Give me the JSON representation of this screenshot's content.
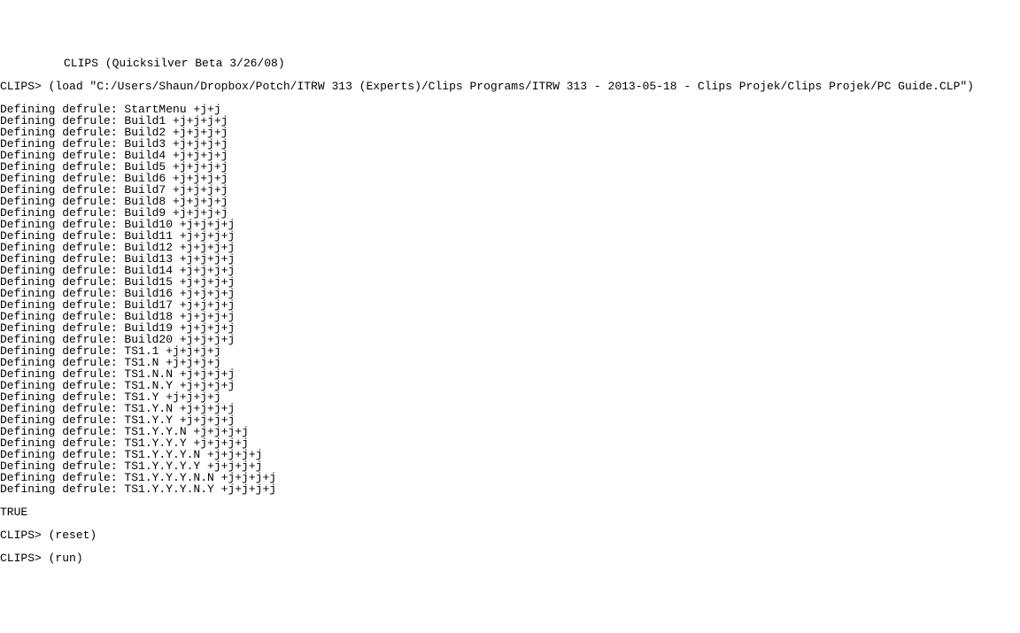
{
  "header": "CLIPS (Quicksilver Beta 3/26/08)",
  "load_line": "CLIPS> (load \"C:/Users/Shaun/Dropbox/Potch/ITRW 313 (Experts)/Clips Programs/ITRW 313 - 2013-05-18 - Clips Projek/Clips Projek/PC Guide.CLP\")",
  "defrules": [
    "Defining defrule: StartMenu +j+j",
    "Defining defrule: Build1 +j+j+j+j",
    "Defining defrule: Build2 +j+j+j+j",
    "Defining defrule: Build3 +j+j+j+j",
    "Defining defrule: Build4 +j+j+j+j",
    "Defining defrule: Build5 +j+j+j+j",
    "Defining defrule: Build6 +j+j+j+j",
    "Defining defrule: Build7 +j+j+j+j",
    "Defining defrule: Build8 +j+j+j+j",
    "Defining defrule: Build9 +j+j+j+j",
    "Defining defrule: Build10 +j+j+j+j",
    "Defining defrule: Build11 +j+j+j+j",
    "Defining defrule: Build12 +j+j+j+j",
    "Defining defrule: Build13 +j+j+j+j",
    "Defining defrule: Build14 +j+j+j+j",
    "Defining defrule: Build15 +j+j+j+j",
    "Defining defrule: Build16 +j+j+j+j",
    "Defining defrule: Build17 +j+j+j+j",
    "Defining defrule: Build18 +j+j+j+j",
    "Defining defrule: Build19 +j+j+j+j",
    "Defining defrule: Build20 +j+j+j+j",
    "Defining defrule: TS1.1 +j+j+j+j",
    "Defining defrule: TS1.N +j+j+j+j",
    "Defining defrule: TS1.N.N +j+j+j+j",
    "Defining defrule: TS1.N.Y +j+j+j+j",
    "Defining defrule: TS1.Y +j+j+j+j",
    "Defining defrule: TS1.Y.N +j+j+j+j",
    "Defining defrule: TS1.Y.Y +j+j+j+j",
    "Defining defrule: TS1.Y.Y.N +j+j+j+j",
    "Defining defrule: TS1.Y.Y.Y +j+j+j+j",
    "Defining defrule: TS1.Y.Y.Y.N +j+j+j+j",
    "Defining defrule: TS1.Y.Y.Y.Y +j+j+j+j",
    "Defining defrule: TS1.Y.Y.Y.N.N +j+j+j+j",
    "Defining defrule: TS1.Y.Y.Y.N.Y +j+j+j+j"
  ],
  "result": "TRUE",
  "reset_line": "CLIPS> (reset)",
  "run_line": "CLIPS> (run)"
}
